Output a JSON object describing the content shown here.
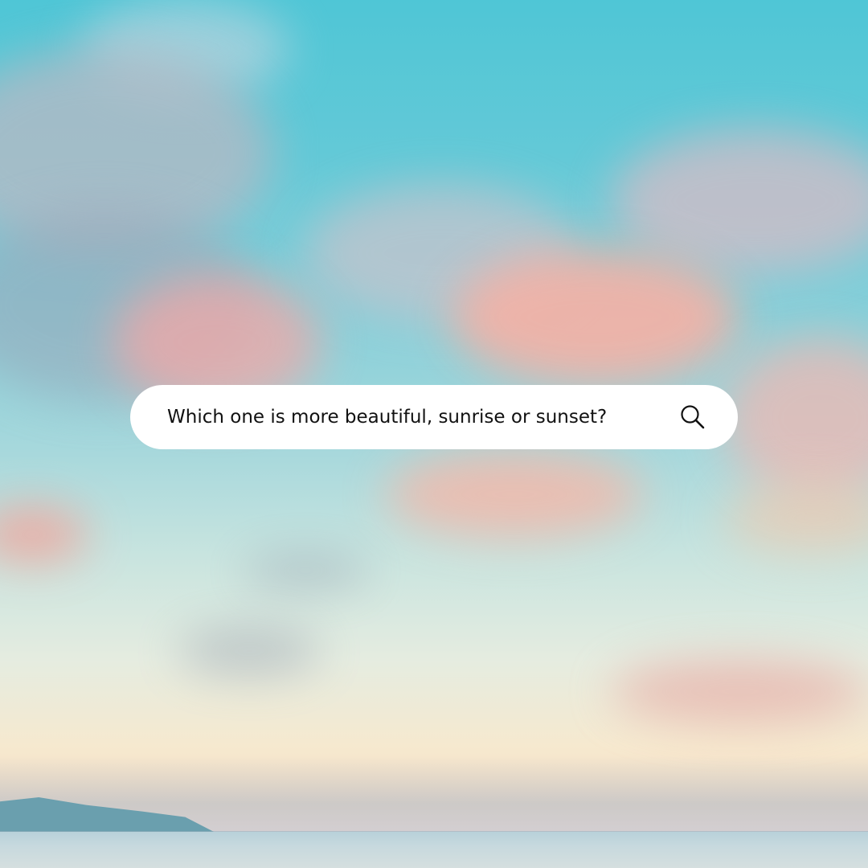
{
  "search": {
    "query": "Which one is more beautiful, sunrise or sunset?",
    "icon": "search-icon"
  },
  "colors": {
    "sky_top": "#4fc6d6",
    "sky_bottom": "#f9dcc3",
    "search_bar_bg": "#ffffff",
    "search_text": "#111111"
  }
}
